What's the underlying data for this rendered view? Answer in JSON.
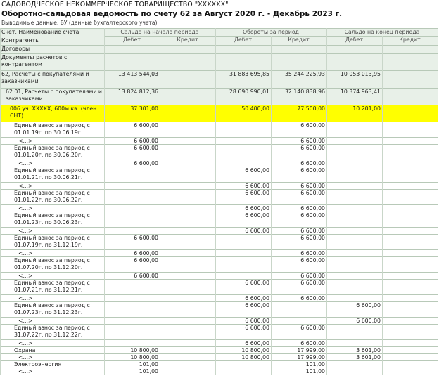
{
  "header": {
    "org": "САДОВОДЧЕСКОЕ НЕКОММЕРЧЕСКОЕ ТОВАРИЩЕСТВО \"ХХХХХХ\"",
    "title": "Оборотно-сальдовая ведомость по счету 62 за Август 2020 г. - Декабрь 2023 г.",
    "params": "Выводимые данные: БУ (данные бухгалтерского учета)"
  },
  "columns": {
    "account_headers": [
      "Счет, Наименование счета",
      "Контрагенты",
      "Договоры",
      "Документы расчетов с контрагентом"
    ],
    "groups": [
      "Сальдо на начало периода",
      "Обороты за период",
      "Сальдо на конец периода"
    ],
    "debit": "Дебет",
    "credit": "Кредит"
  },
  "rows": [
    {
      "label": "62, Расчеты с покупателями и заказчиками",
      "h": 25,
      "style": "grp",
      "indent": 2,
      "v": [
        "13 413 544,03",
        "",
        "31 883 695,85",
        "35 244 225,93",
        "10 053 013,95",
        ""
      ]
    },
    {
      "label": "62.01, Расчеты с покупателями и заказчиками",
      "h": 24,
      "style": "grp",
      "indent": 8,
      "v": [
        "13 824 812,36",
        "",
        "28 690 990,01",
        "32 140 838,96",
        "10 374 963,41",
        ""
      ]
    },
    {
      "label": "006 уч. XXXXX, 600м.кв. (член СНТ)",
      "h": 24,
      "style": "hl",
      "indent": 14,
      "v": [
        "37 301,00",
        "",
        "50 400,00",
        "77 500,00",
        "10 201,00",
        ""
      ]
    },
    {
      "label": "Единый взнос за период с 01.01.19г. по 30.06.19г.",
      "h": 22,
      "indent": 20,
      "v": [
        "6 600,00",
        "",
        "",
        "6 600,00",
        "",
        ""
      ]
    },
    {
      "label": "<...>",
      "h": 10,
      "indent": 26,
      "v": [
        "6 600,00",
        "",
        "",
        "6 600,00",
        "",
        ""
      ]
    },
    {
      "label": "Единый взнос за период с 01.01.20г. по 30.06.20г.",
      "h": 22,
      "indent": 20,
      "v": [
        "6 600,00",
        "",
        "",
        "6 600,00",
        "",
        ""
      ]
    },
    {
      "label": "<...>",
      "h": 10,
      "indent": 26,
      "v": [
        "6 600,00",
        "",
        "",
        "6 600,00",
        "",
        ""
      ]
    },
    {
      "label": "Единый взнос за период с 01.01.21г. по 30.06.21г.",
      "h": 22,
      "indent": 20,
      "v": [
        "",
        "",
        "6 600,00",
        "6 600,00",
        "",
        ""
      ]
    },
    {
      "label": "<...>",
      "h": 10,
      "indent": 26,
      "v": [
        "",
        "",
        "6 600,00",
        "6 600,00",
        "",
        ""
      ]
    },
    {
      "label": "Единый взнос за период с 01.01.22г. по 30.06.22г.",
      "h": 22,
      "indent": 20,
      "v": [
        "",
        "",
        "6 600,00",
        "6 600,00",
        "",
        ""
      ]
    },
    {
      "label": "<...>",
      "h": 10,
      "indent": 26,
      "v": [
        "",
        "",
        "6 600,00",
        "6 600,00",
        "",
        ""
      ]
    },
    {
      "label": "Единый взнос за период с 01.01.23г. по 30.06.23г.",
      "h": 22,
      "indent": 20,
      "v": [
        "",
        "",
        "6 600,00",
        "6 600,00",
        "",
        ""
      ]
    },
    {
      "label": "<...>",
      "h": 10,
      "indent": 26,
      "v": [
        "",
        "",
        "6 600,00",
        "6 600,00",
        "",
        ""
      ]
    },
    {
      "label": "Единый взнос за период с 01.07.19г. по 31.12.19г.",
      "h": 22,
      "indent": 20,
      "v": [
        "6 600,00",
        "",
        "",
        "6 600,00",
        "",
        ""
      ]
    },
    {
      "label": "<...>",
      "h": 10,
      "indent": 26,
      "v": [
        "6 600,00",
        "",
        "",
        "6 600,00",
        "",
        ""
      ]
    },
    {
      "label": "Единый взнос за период с 01.07.20г. по 31.12.20г.",
      "h": 22,
      "indent": 20,
      "v": [
        "6 600,00",
        "",
        "",
        "6 600,00",
        "",
        ""
      ]
    },
    {
      "label": "<...>",
      "h": 10,
      "indent": 26,
      "v": [
        "6 600,00",
        "",
        "",
        "6 600,00",
        "",
        ""
      ]
    },
    {
      "label": "Единый взнос за период с 01.07.21г. по 31.12.21г.",
      "h": 22,
      "indent": 20,
      "v": [
        "",
        "",
        "6 600,00",
        "6 600,00",
        "",
        ""
      ]
    },
    {
      "label": "<...>",
      "h": 10,
      "indent": 26,
      "v": [
        "",
        "",
        "6 600,00",
        "6 600,00",
        "",
        ""
      ]
    },
    {
      "label": "Единый взнос за период с 01.07.23г. по 31.12.23г.",
      "h": 22,
      "indent": 20,
      "v": [
        "",
        "",
        "6 600,00",
        "",
        "6 600,00",
        ""
      ]
    },
    {
      "label": "<...>",
      "h": 10,
      "indent": 26,
      "v": [
        "",
        "",
        "6 600,00",
        "",
        "6 600,00",
        ""
      ]
    },
    {
      "label": "Единый взнос за период с 31.07.22г. по 31.12.22г.",
      "h": 22,
      "indent": 20,
      "v": [
        "",
        "",
        "6 600,00",
        "6 600,00",
        "",
        ""
      ]
    },
    {
      "label": "<...>",
      "h": 10,
      "indent": 26,
      "v": [
        "",
        "",
        "6 600,00",
        "6 600,00",
        "",
        ""
      ]
    },
    {
      "label": "Охрана",
      "h": 10,
      "indent": 20,
      "v": [
        "10 800,00",
        "",
        "10 800,00",
        "17 999,00",
        "3 601,00",
        ""
      ]
    },
    {
      "label": "<...>",
      "h": 10,
      "indent": 26,
      "v": [
        "10 800,00",
        "",
        "10 800,00",
        "17 999,00",
        "3 601,00",
        ""
      ]
    },
    {
      "label": "Электроэнергия",
      "h": 10,
      "indent": 20,
      "v": [
        "101,00",
        "",
        "",
        "101,00",
        "",
        ""
      ]
    },
    {
      "label": "<...>",
      "h": 10,
      "indent": 26,
      "v": [
        "101,00",
        "",
        "",
        "101,00",
        "",
        ""
      ]
    }
  ]
}
